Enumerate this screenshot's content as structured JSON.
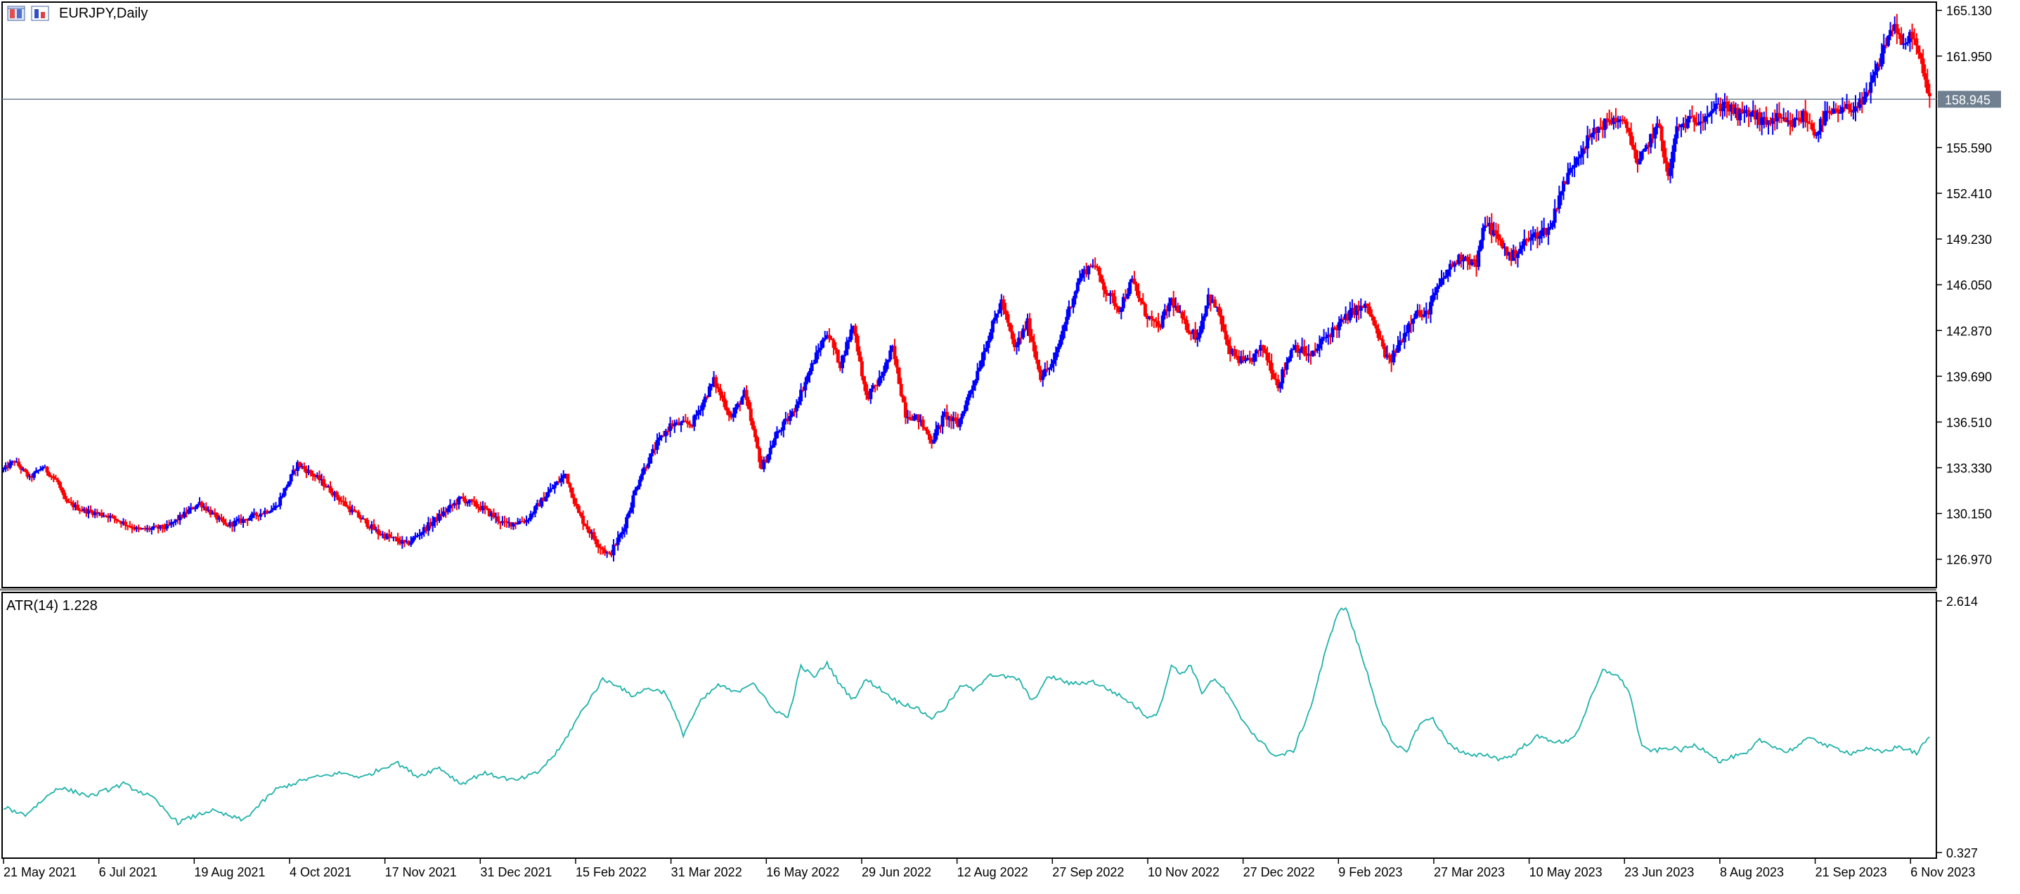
{
  "window": {
    "symbol_title": "EURJPY,Daily",
    "indicator_label": "ATR(14) 1.228"
  },
  "icons": [
    "chart-window-icon",
    "chart-properties-icon"
  ],
  "colors": {
    "bull": "#0000ff",
    "bear": "#ff0000",
    "atr": "#20b2aa",
    "bid_line": "#708090",
    "background": "#ffffff",
    "frame": "#000000"
  },
  "chart_data": [
    {
      "type": "candlestick",
      "title": "EURJPY,Daily",
      "ylim": [
        125.0,
        165.7
      ],
      "y_ticks": [
        "165.130",
        "161.950",
        "158.945",
        "155.590",
        "152.410",
        "149.230",
        "146.050",
        "142.870",
        "139.690",
        "136.510",
        "133.330",
        "130.150",
        "126.970"
      ],
      "current_price": 158.945,
      "x_tick_labels": [
        "21 May 2021",
        "6 Jul 2021",
        "19 Aug 2021",
        "4 Oct 2021",
        "17 Nov 2021",
        "31 Dec 2021",
        "15 Feb 2022",
        "31 Mar 2022",
        "16 May 2022",
        "29 Jun 2022",
        "12 Aug 2022",
        "27 Sep 2022",
        "10 Nov 2022",
        "27 Dec 2022",
        "9 Feb 2023",
        "27 Mar 2023",
        "10 May 2023",
        "23 Jun 2023",
        "8 Aug 2023",
        "21 Sep 2023",
        "6 Nov 2023"
      ],
      "close_path": [
        [
          0,
          133.2
        ],
        [
          5,
          133.8
        ],
        [
          12,
          132.6
        ],
        [
          18,
          133.4
        ],
        [
          25,
          132.3
        ],
        [
          28,
          131.0
        ],
        [
          36,
          130.4
        ],
        [
          48,
          130.0
        ],
        [
          62,
          129.0
        ],
        [
          75,
          129.2
        ],
        [
          90,
          130.9
        ],
        [
          102,
          129.3
        ],
        [
          110,
          129.7
        ],
        [
          125,
          130.6
        ],
        [
          135,
          133.6
        ],
        [
          145,
          132.5
        ],
        [
          160,
          130.3
        ],
        [
          172,
          128.8
        ],
        [
          185,
          128.0
        ],
        [
          198,
          129.7
        ],
        [
          210,
          131.2
        ],
        [
          220,
          130.5
        ],
        [
          230,
          129.4
        ],
        [
          240,
          129.7
        ],
        [
          250,
          131.6
        ],
        [
          258,
          132.9
        ],
        [
          264,
          130.1
        ],
        [
          272,
          128.2
        ],
        [
          278,
          127.2
        ],
        [
          284,
          128.9
        ],
        [
          292,
          132.7
        ],
        [
          300,
          135.0
        ],
        [
          306,
          136.3
        ],
        [
          316,
          136.4
        ],
        [
          326,
          139.4
        ],
        [
          334,
          136.8
        ],
        [
          340,
          138.5
        ],
        [
          348,
          133.3
        ],
        [
          355,
          135.7
        ],
        [
          362,
          137.1
        ],
        [
          372,
          140.8
        ],
        [
          378,
          142.8
        ],
        [
          384,
          140.5
        ],
        [
          390,
          143.3
        ],
        [
          396,
          138.2
        ],
        [
          402,
          139.4
        ],
        [
          408,
          141.6
        ],
        [
          414,
          137.1
        ],
        [
          420,
          136.7
        ],
        [
          426,
          135.2
        ],
        [
          432,
          137.0
        ],
        [
          438,
          136.3
        ],
        [
          446,
          139.6
        ],
        [
          452,
          142.4
        ],
        [
          458,
          144.9
        ],
        [
          464,
          141.6
        ],
        [
          470,
          143.4
        ],
        [
          476,
          139.7
        ],
        [
          482,
          140.6
        ],
        [
          488,
          143.9
        ],
        [
          494,
          146.6
        ],
        [
          500,
          147.6
        ],
        [
          506,
          145.6
        ],
        [
          512,
          144.4
        ],
        [
          518,
          146.3
        ],
        [
          524,
          144.1
        ],
        [
          530,
          143.0
        ],
        [
          536,
          145.0
        ],
        [
          542,
          143.3
        ],
        [
          548,
          142.4
        ],
        [
          553,
          145.3
        ],
        [
          558,
          144.0
        ],
        [
          562,
          141.5
        ],
        [
          570,
          140.5
        ],
        [
          578,
          141.7
        ],
        [
          585,
          139.1
        ],
        [
          592,
          141.9
        ],
        [
          600,
          141.0
        ],
        [
          606,
          142.3
        ],
        [
          613,
          143.3
        ],
        [
          620,
          144.3
        ],
        [
          626,
          144.5
        ],
        [
          632,
          142.0
        ],
        [
          636,
          140.6
        ],
        [
          642,
          142.4
        ],
        [
          648,
          144.3
        ],
        [
          652,
          143.7
        ],
        [
          658,
          145.7
        ],
        [
          664,
          147.3
        ],
        [
          670,
          148.1
        ],
        [
          676,
          147.4
        ],
        [
          680,
          150.5
        ],
        [
          686,
          149.2
        ],
        [
          692,
          147.9
        ],
        [
          698,
          149.0
        ],
        [
          704,
          149.6
        ],
        [
          710,
          150.0
        ],
        [
          714,
          152.3
        ],
        [
          722,
          155.0
        ],
        [
          728,
          156.3
        ],
        [
          734,
          157.2
        ],
        [
          740,
          157.6
        ],
        [
          746,
          156.8
        ],
        [
          750,
          154.2
        ],
        [
          756,
          156.3
        ],
        [
          760,
          157.1
        ],
        [
          764,
          153.4
        ],
        [
          768,
          156.9
        ],
        [
          772,
          157.3
        ],
        [
          778,
          157.6
        ],
        [
          784,
          158.2
        ],
        [
          790,
          158.6
        ],
        [
          796,
          157.8
        ],
        [
          802,
          158.0
        ],
        [
          808,
          157.3
        ],
        [
          814,
          157.6
        ],
        [
          820,
          157.1
        ],
        [
          826,
          157.8
        ],
        [
          832,
          156.6
        ],
        [
          836,
          157.8
        ],
        [
          842,
          158.0
        ],
        [
          848,
          158.4
        ],
        [
          854,
          158.7
        ],
        [
          860,
          161.1
        ],
        [
          864,
          163.0
        ],
        [
          868,
          164.2
        ],
        [
          872,
          162.4
        ],
        [
          876,
          163.6
        ],
        [
          880,
          161.4
        ],
        [
          884,
          158.9
        ]
      ]
    },
    {
      "type": "line",
      "title": "ATR(14) 1.228",
      "ylim": [
        0.327,
        2.614
      ],
      "y_ticks": [
        "2.614",
        "0.327"
      ],
      "series": [
        {
          "name": "ATR(14)",
          "current_value": 1.228,
          "points": [
            [
              0,
              0.74
            ],
            [
              10,
              0.67
            ],
            [
              25,
              0.92
            ],
            [
              40,
              0.84
            ],
            [
              55,
              0.95
            ],
            [
              68,
              0.83
            ],
            [
              80,
              0.6
            ],
            [
              95,
              0.71
            ],
            [
              110,
              0.62
            ],
            [
              125,
              0.9
            ],
            [
              140,
              1.0
            ],
            [
              155,
              1.05
            ],
            [
              165,
              1.01
            ],
            [
              180,
              1.15
            ],
            [
              190,
              1.02
            ],
            [
              200,
              1.1
            ],
            [
              210,
              0.95
            ],
            [
              220,
              1.05
            ],
            [
              235,
              0.98
            ],
            [
              245,
              1.05
            ],
            [
              255,
              1.26
            ],
            [
              265,
              1.6
            ],
            [
              275,
              1.9
            ],
            [
              282,
              1.85
            ],
            [
              288,
              1.75
            ],
            [
              296,
              1.82
            ],
            [
              304,
              1.78
            ],
            [
              312,
              1.4
            ],
            [
              320,
              1.7
            ],
            [
              328,
              1.85
            ],
            [
              336,
              1.78
            ],
            [
              344,
              1.88
            ],
            [
              352,
              1.65
            ],
            [
              360,
              1.55
            ],
            [
              366,
              2.02
            ],
            [
              372,
              1.92
            ],
            [
              378,
              2.05
            ],
            [
              384,
              1.85
            ],
            [
              390,
              1.72
            ],
            [
              396,
              1.9
            ],
            [
              402,
              1.82
            ],
            [
              410,
              1.7
            ],
            [
              418,
              1.65
            ],
            [
              426,
              1.55
            ],
            [
              432,
              1.64
            ],
            [
              440,
              1.85
            ],
            [
              446,
              1.8
            ],
            [
              452,
              1.95
            ],
            [
              458,
              1.93
            ],
            [
              466,
              1.9
            ],
            [
              472,
              1.7
            ],
            [
              480,
              1.93
            ],
            [
              490,
              1.86
            ],
            [
              500,
              1.88
            ],
            [
              510,
              1.78
            ],
            [
              518,
              1.68
            ],
            [
              525,
              1.56
            ],
            [
              530,
              1.6
            ],
            [
              536,
              2.03
            ],
            [
              540,
              1.95
            ],
            [
              545,
              2.03
            ],
            [
              550,
              1.78
            ],
            [
              555,
              1.9
            ],
            [
              560,
              1.82
            ],
            [
              568,
              1.55
            ],
            [
              576,
              1.35
            ],
            [
              584,
              1.2
            ],
            [
              592,
              1.25
            ],
            [
              600,
              1.65
            ],
            [
              606,
              2.1
            ],
            [
              612,
              2.5
            ],
            [
              616,
              2.56
            ],
            [
              620,
              2.32
            ],
            [
              626,
              1.95
            ],
            [
              632,
              1.55
            ],
            [
              638,
              1.3
            ],
            [
              644,
              1.25
            ],
            [
              650,
              1.5
            ],
            [
              656,
              1.55
            ],
            [
              662,
              1.35
            ],
            [
              668,
              1.25
            ],
            [
              674,
              1.2
            ],
            [
              680,
              1.22
            ],
            [
              686,
              1.18
            ],
            [
              692,
              1.2
            ],
            [
              698,
              1.3
            ],
            [
              704,
              1.38
            ],
            [
              710,
              1.35
            ],
            [
              716,
              1.32
            ],
            [
              722,
              1.41
            ],
            [
              728,
              1.7
            ],
            [
              734,
              1.98
            ],
            [
              740,
              1.95
            ],
            [
              746,
              1.8
            ],
            [
              752,
              1.28
            ],
            [
              758,
              1.25
            ],
            [
              764,
              1.28
            ],
            [
              770,
              1.26
            ],
            [
              776,
              1.3
            ],
            [
              782,
              1.25
            ],
            [
              788,
              1.15
            ],
            [
              794,
              1.2
            ],
            [
              800,
              1.22
            ],
            [
              806,
              1.35
            ],
            [
              812,
              1.3
            ],
            [
              818,
              1.24
            ],
            [
              824,
              1.3
            ],
            [
              830,
              1.38
            ],
            [
              836,
              1.3
            ],
            [
              842,
              1.27
            ],
            [
              848,
              1.23
            ],
            [
              854,
              1.27
            ],
            [
              862,
              1.24
            ],
            [
              870,
              1.29
            ],
            [
              878,
              1.23
            ],
            [
              884,
              1.38
            ]
          ]
        }
      ]
    }
  ]
}
